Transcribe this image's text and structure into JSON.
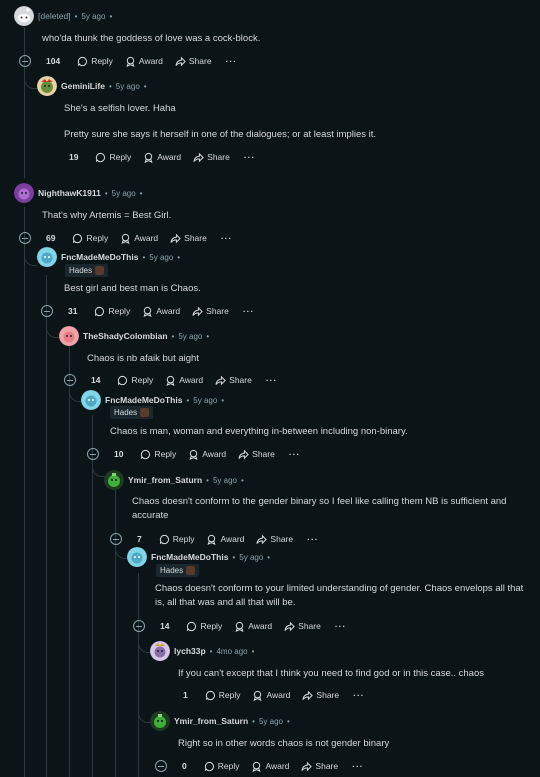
{
  "actions": {
    "reply": "Reply",
    "award": "Award",
    "share": "Share",
    "more": "···"
  },
  "comments": [
    {
      "author": "[deleted]",
      "sep": "•",
      "time": "5y ago",
      "sep2": "•",
      "text": "who'da thunk the goddess of love was a cock-block.",
      "votes": "104"
    },
    {
      "author": "GeminiLife",
      "sep": "•",
      "time": "5y ago",
      "sep2": "•",
      "text": "She's a selfish lover. Haha",
      "text2": "Pretty sure she says it herself in one of the dialogues; or at least implies it.",
      "votes": "19"
    },
    {
      "author": "NighthawK1911",
      "sep": "•",
      "time": "5y ago",
      "sep2": "•",
      "text": "That's why Artemis = Best Girl.",
      "votes": "69"
    },
    {
      "author": "FncMadeMeDoThis",
      "sep": "•",
      "time": "5y ago",
      "sep2": "•",
      "flair": "Hades",
      "text": "Best girl and best man is Chaos.",
      "votes": "31"
    },
    {
      "author": "TheShadyColombian",
      "sep": "•",
      "time": "5y ago",
      "sep2": "•",
      "text": "Chaos is nb afaik but aight",
      "votes": "14"
    },
    {
      "author": "FncMadeMeDoThis",
      "sep": "•",
      "time": "5y ago",
      "sep2": "•",
      "flair": "Hades",
      "text": "Chaos is man, woman and everything in-between including non-binary.",
      "votes": "10"
    },
    {
      "author": "Ymir_from_Saturn",
      "sep": "•",
      "time": "5y ago",
      "sep2": "•",
      "text": "Chaos doesn't conform to the gender binary so I feel like calling them NB is sufficient and accurate",
      "votes": "7"
    },
    {
      "author": "FncMadeMeDoThis",
      "sep": "•",
      "time": "5y ago",
      "sep2": "•",
      "flair": "Hades",
      "text": "Chaos doesn't conform to your limited understanding of gender. Chaos envelops all that is, all that was and all that will be.",
      "votes": "14"
    },
    {
      "author": "lych33p",
      "sep": "•",
      "time": "4mo ago",
      "sep2": "•",
      "text": "If you can't except that I think you need to find god or in this case.. chaos",
      "votes": "1"
    },
    {
      "author": "Ymir_from_Saturn",
      "sep": "•",
      "time": "5y ago",
      "sep2": "•",
      "text": "Right so in other words chaos is not gender binary",
      "votes": "0"
    }
  ],
  "colors": {
    "background": "#0b1416",
    "text": "#d7dadc",
    "muted": "#8ba2ad",
    "thread": "#2a3c42"
  }
}
